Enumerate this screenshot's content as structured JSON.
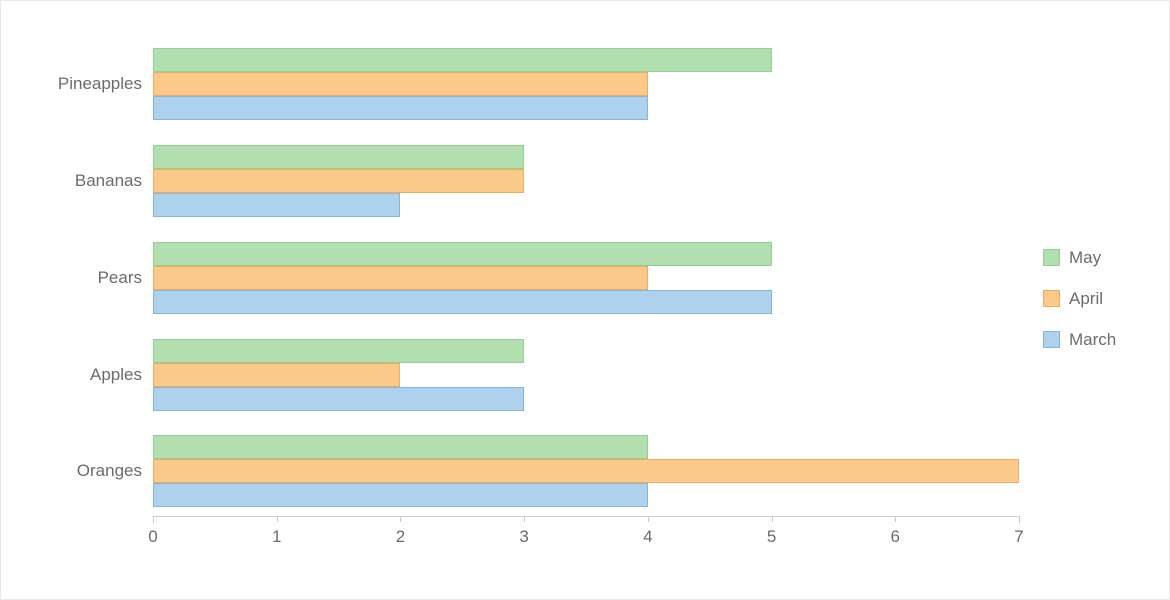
{
  "chart_data": {
    "type": "bar",
    "orientation": "horizontal",
    "title": "",
    "subtitle": "",
    "xlabel": "",
    "ylabel": "",
    "categories": [
      "Pineapples",
      "Bananas",
      "Pears",
      "Apples",
      "Oranges"
    ],
    "series": [
      {
        "name": "May",
        "color": "#b1dfb0",
        "border_color": "#93cf92",
        "values": [
          5,
          3,
          5,
          3,
          4
        ]
      },
      {
        "name": "April",
        "color": "#fbc98a",
        "border_color": "#f0ab5e",
        "values": [
          4,
          3,
          4,
          2,
          7
        ]
      },
      {
        "name": "March",
        "color": "#aed2ed",
        "border_color": "#82b6dd",
        "values": [
          4,
          2,
          5,
          3,
          4
        ]
      }
    ],
    "xlim": [
      0,
      7
    ],
    "xticks": [
      0,
      1,
      2,
      3,
      4,
      5,
      6,
      7
    ],
    "xtick_labels": [
      "0",
      "1",
      "2",
      "3",
      "4",
      "5",
      "6",
      "7"
    ],
    "grid": false,
    "legend_position": "right",
    "axis_color": "#cccccc",
    "text_color": "#6b6b6b",
    "background": "#ffffff"
  },
  "legend": {
    "items": [
      {
        "label": "May"
      },
      {
        "label": "April"
      },
      {
        "label": "March"
      }
    ]
  }
}
